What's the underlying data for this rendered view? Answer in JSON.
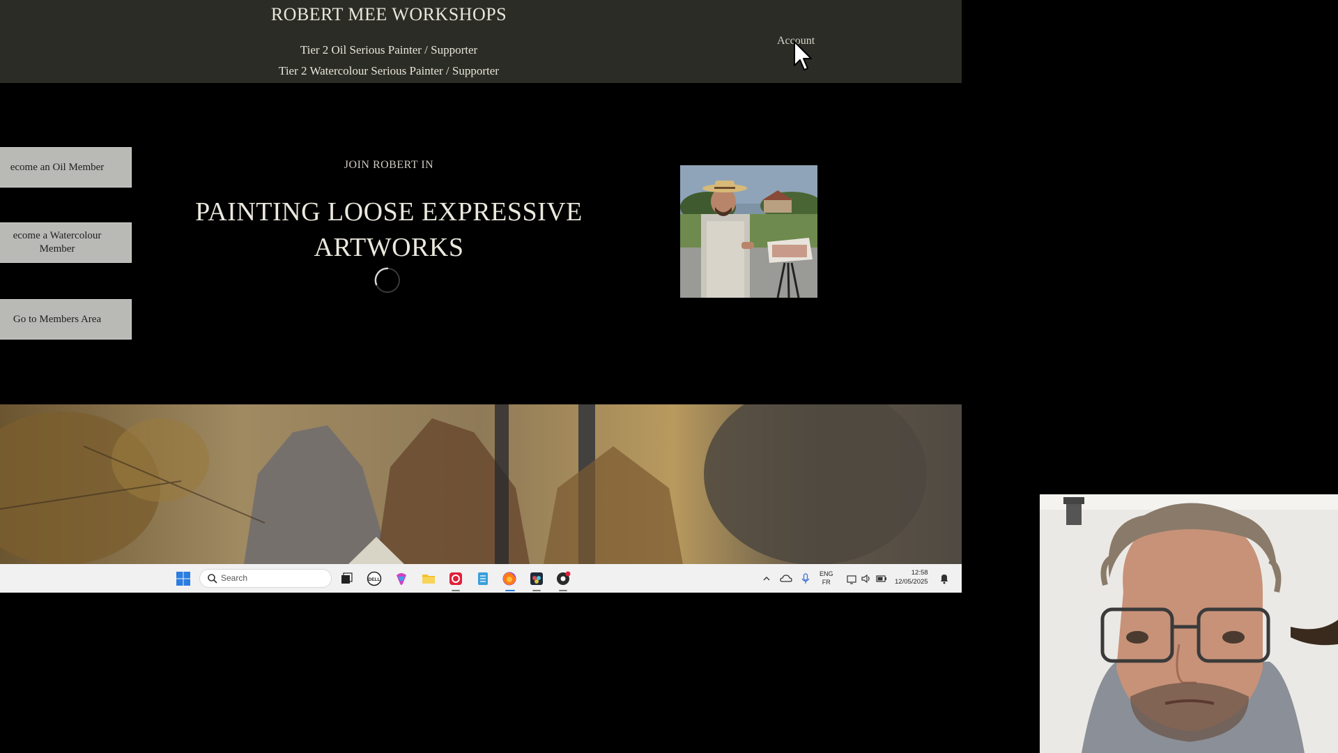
{
  "site": {
    "brand": "ROBERT MEE WORKSHOPS",
    "nav": {
      "tier_oil": "Tier 2 Oil Serious Painter / Supporter",
      "tier_watercolour": "Tier 2 Watercolour Serious Painter / Supporter",
      "account": "Account"
    }
  },
  "sidebar": {
    "oil_member": "ecome an Oil Member",
    "watercolour_member": "ecome a Watercolour Member",
    "members_area": "Go to Members Area"
  },
  "hero": {
    "kicker": "JOIN ROBERT IN",
    "title": "PAINTING LOOSE EXPRESSIVE ARTWORKS"
  },
  "taskbar": {
    "search_placeholder": "Search",
    "lang_primary": "ENG",
    "lang_secondary": "FR",
    "time": "12:58",
    "date": "12/05/2025"
  },
  "colors": {
    "header_bg": "#2b2c25",
    "button_bg": "#b9b9b6",
    "page_bg": "#000000",
    "taskbar_bg": "#f1f1f2"
  }
}
